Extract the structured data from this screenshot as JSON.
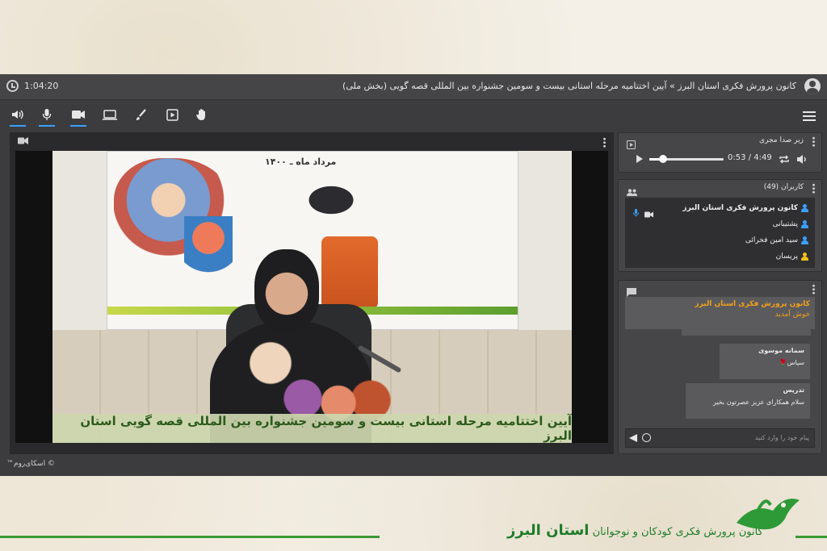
{
  "window": {
    "elapsed_time": "1:04:20",
    "title": "کانون پرورش فکری استان البرز  »  آیین اختتامیه مرحله استانی بیست و سومین جشنواره بین المللی قصه گویی (بخش ملی)"
  },
  "toolbar": {
    "icons": [
      "speaker-icon",
      "microphone-icon",
      "camera-icon",
      "screen-share-icon",
      "whiteboard-brush-icon",
      "media-play-icon",
      "raise-hand-icon"
    ],
    "accent_color": "#3aa0ff"
  },
  "video": {
    "banner_date": "مرداد ماه ـ ۱۴۰۰",
    "caption": "آیین اختتامیه مرحله استانی بیست و سومین جشنواره بین المللی قصه گویی استان البرز"
  },
  "media_player": {
    "title": "زیر صدا مجری",
    "current_time": "0:53",
    "separator": "/",
    "duration": "4:49",
    "progress": 0.18
  },
  "users": {
    "title": "کاربران (49)",
    "list": [
      {
        "name": "کانون پرورش فکری استان البرز",
        "color": "#3aa0ff",
        "bold": true
      },
      {
        "name": "پشتیبانی",
        "color": "#3aa0ff",
        "bold": false
      },
      {
        "name": "سید امین فخرائی",
        "color": "#3aa0ff",
        "bold": false
      },
      {
        "name": "پریسان",
        "color": "#f3c21a",
        "bold": false
      }
    ]
  },
  "chat": {
    "welcome_sender": "کانون پرورش فکری استان البرز",
    "welcome_message": "خوش آمدید",
    "messages": [
      {
        "sender": "سمانه موسوی",
        "text": "سپاس🌹"
      },
      {
        "sender": "تدریس",
        "text": "سلام همکارای عزیز عصرتون بخیر"
      }
    ],
    "input_placeholder": "پیام خود را وارد کنید"
  },
  "footer": {
    "copyright": "© اسکای‌روم™"
  },
  "brand": {
    "line1": "کانون پرورش فکری کودکان و نوجوانان",
    "line2": "استان البرز",
    "color": "#1d7d2a"
  }
}
